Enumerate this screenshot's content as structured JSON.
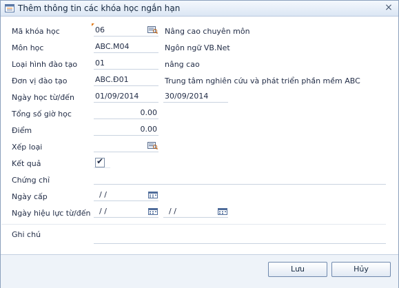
{
  "window": {
    "title": "Thêm thông tin các khóa học ngắn hạn",
    "close_glyph": "×",
    "icon": "window-app-icon"
  },
  "form": {
    "ma_khoa_hoc": {
      "label": "Mã khóa học",
      "value": "06",
      "description": "Nâng cao chuyên môn"
    },
    "mon_hoc": {
      "label": "Môn học",
      "value": "ABC.M04",
      "description": "Ngôn ngữ VB.Net"
    },
    "loai_hinh_dao_tao": {
      "label": "Loại hình đào tạo",
      "value": "01",
      "description": "nâng cao"
    },
    "don_vi_dao_tao": {
      "label": "Đơn vị đào tạo",
      "value": "ABC.Đ01",
      "description": "Trung tâm nghiên cứu và phát triển phần mềm ABC"
    },
    "ngay_hoc": {
      "label": "Ngày học từ/đến",
      "from": "01/09/2014",
      "to": "30/09/2014"
    },
    "tong_so_gio_hoc": {
      "label": "Tổng số giờ học",
      "value": "0.00"
    },
    "diem": {
      "label": "Điểm",
      "value": "0.00"
    },
    "xep_loai": {
      "label": "Xếp loại",
      "value": ""
    },
    "ket_qua": {
      "label": "Kết quả",
      "checked": true,
      "check_glyph": "✔"
    },
    "chung_chi": {
      "label": "Chứng chỉ",
      "value": ""
    },
    "ngay_cap": {
      "label": "Ngày cấp",
      "value": " /  /"
    },
    "ngay_hieu_luc": {
      "label": "Ngày hiệu lực từ/đến",
      "from": " /  /",
      "to": " /  /"
    },
    "ghi_chu": {
      "label": "Ghi chú",
      "value": ""
    }
  },
  "buttons": {
    "save": "Lưu",
    "cancel": "Hủy"
  },
  "colors": {
    "accent": "#e07a1a",
    "frame": "#8ba0bc",
    "underline": "#c9d3e0"
  }
}
